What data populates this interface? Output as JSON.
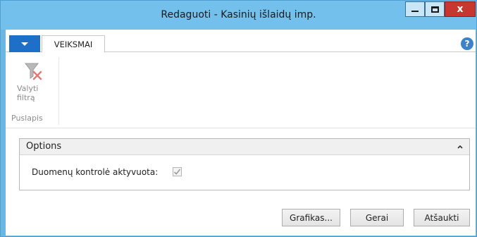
{
  "window": {
    "title": "Redaguoti - Kasinių išlaidų imp.",
    "min_icon": "minimize-icon",
    "max_icon": "maximize-icon",
    "close_glyph": "x",
    "accent": "#74c0ec"
  },
  "ribbon": {
    "tabs": [
      {
        "label": "VEIKSMAI"
      }
    ],
    "help_glyph": "?",
    "groups": [
      {
        "label": "Puslapis",
        "buttons": [
          {
            "label": "Valyti\nfiltrą",
            "icon": "clear-filter-icon"
          }
        ]
      }
    ]
  },
  "options": {
    "title": "Options",
    "fields": [
      {
        "label": "Duomenų kontrolė aktyvuota:",
        "checked": true
      }
    ]
  },
  "buttons": {
    "graph": "Grafikas...",
    "ok": "Gerai",
    "cancel": "Atšaukti"
  }
}
